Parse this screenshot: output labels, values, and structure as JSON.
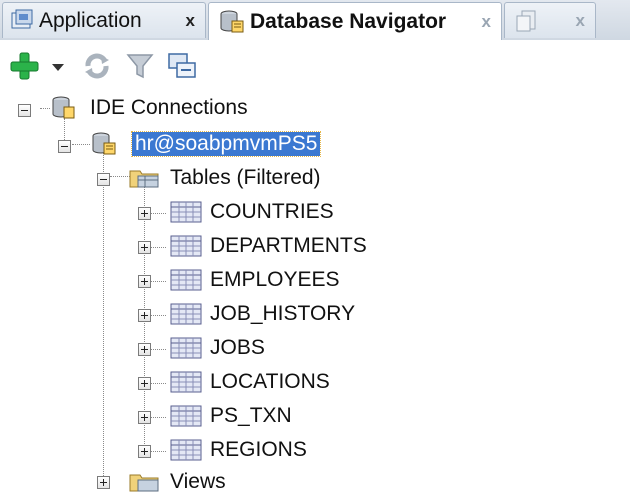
{
  "tabs": [
    {
      "label": "Application",
      "close": "x"
    },
    {
      "label": "Database Navigator",
      "close": "x"
    },
    {
      "label": "",
      "close": "x"
    }
  ],
  "toolbar": {
    "icons": [
      "add-icon",
      "dropdown-arrow-icon",
      "refresh-icon",
      "filter-icon",
      "collapse-icon"
    ]
  },
  "tree": {
    "root": "IDE Connections",
    "connection": "hr@soabpmvmPS5",
    "tables_folder": "Tables (Filtered)",
    "tables": [
      "COUNTRIES",
      "DEPARTMENTS",
      "EMPLOYEES",
      "JOB_HISTORY",
      "JOBS",
      "LOCATIONS",
      "PS_TXN",
      "REGIONS"
    ],
    "views_folder": "Views"
  },
  "colors": {
    "selection": "#3b78d1",
    "add_icon": "#2bb34a",
    "tab_bar": "#dce4ed"
  }
}
